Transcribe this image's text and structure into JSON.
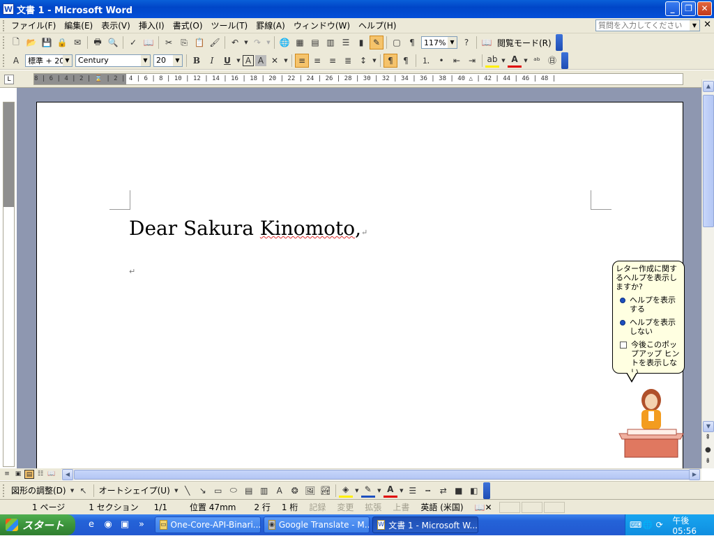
{
  "window": {
    "title": "文書 1 - Microsoft Word",
    "app_icon": "word-icon",
    "buttons": [
      "minimize",
      "restore",
      "close"
    ]
  },
  "menubar": {
    "items": [
      "ファイル(F)",
      "編集(E)",
      "表示(V)",
      "挿入(I)",
      "書式(O)",
      "ツール(T)",
      "罫線(A)",
      "ウィンドウ(W)",
      "ヘルプ(H)"
    ],
    "help_placeholder": "質問を入力してください"
  },
  "standard_toolbar": {
    "zoom": "117%",
    "reading_mode": "閲覧モード(R)"
  },
  "formatting_toolbar": {
    "style": "標準 + 20",
    "font": "Century",
    "size": "20"
  },
  "ruler": {
    "marks": "8 | 6 | 4 | 2 | ⌛ | 2 | 4 | 6 | 8 | 10 | 12 | 14 | 16 | 18 | 20 | 22 | 24 | 26 | 28 | 30 | 32 | 34 | 36 | 38 | 40 △ | 42 | 44 | 46 | 48 |"
  },
  "document": {
    "line1_part1": "Dear Sakura ",
    "line1_misspelled": "Kinomoto",
    "line1_end": ",",
    "para_mark": "↵"
  },
  "balloon": {
    "question": "レター作成に関するヘルプを表示しますか?",
    "option1": "ヘルプを表示する",
    "option2": "ヘルプを表示しない",
    "checkbox": "今後このポップアップ ヒントを表示しない"
  },
  "drawing_toolbar": {
    "draw_menu": "図形の調整(D)",
    "autoshapes": "オートシェイプ(U)"
  },
  "statusbar": {
    "page": "1 ページ",
    "section": "1 セクション",
    "pages": "1/1",
    "position": "位置 47mm",
    "line": "2 行",
    "column": "1 桁",
    "rec": "記録",
    "trk": "変更",
    "ext": "拡張",
    "ovr": "上書",
    "language": "英語 (米国)"
  },
  "taskbar": {
    "start": "スタート",
    "tasks": [
      "One-Core-API-Binari...",
      "Google Translate - M...",
      "文書 1 - Microsoft W..."
    ],
    "clock": "午後 05:56"
  }
}
